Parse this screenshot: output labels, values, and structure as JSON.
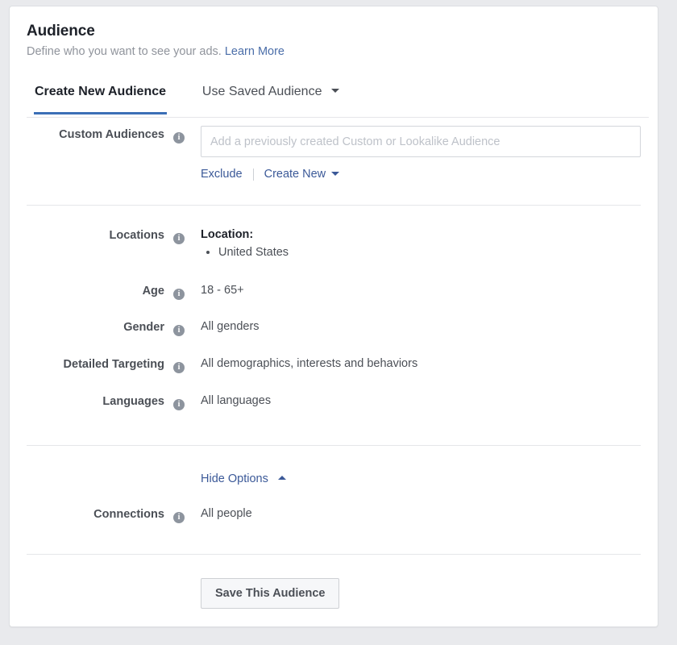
{
  "page": {
    "title": "Audience",
    "subtitle": "Define who you want to see your ads.",
    "learn_more": "Learn More"
  },
  "tabs": [
    {
      "label": "Create New Audience",
      "active": true
    },
    {
      "label": "Use Saved Audience",
      "active": false,
      "caret": "chevron-down"
    }
  ],
  "custom_audiences": {
    "label": "Custom Audiences",
    "info": "i",
    "placeholder": "Add a previously created Custom or Lookalike Audience",
    "value": "",
    "exclude_label": "Exclude",
    "create_new_label": "Create New"
  },
  "locations": {
    "label": "Locations",
    "info": "i",
    "value_title": "Location:",
    "items": [
      "United States"
    ]
  },
  "age": {
    "label": "Age",
    "info": "i",
    "value": "18 - 65+"
  },
  "gender": {
    "label": "Gender",
    "info": "i",
    "value": "All genders"
  },
  "detailed_targeting": {
    "label": "Detailed Targeting",
    "info": "i",
    "value": "All demographics, interests and behaviors"
  },
  "languages": {
    "label": "Languages",
    "info": "i",
    "value": "All languages"
  },
  "options_toggle": {
    "label": "Hide Options"
  },
  "connections": {
    "label": "Connections",
    "info": "i",
    "value": "All people"
  },
  "save_button": {
    "label": "Save This Audience"
  },
  "colors": {
    "accent_blue": "#3b6fb6",
    "link_blue": "#3b5998",
    "subtitle_link_blue": "#4b6ea9",
    "label_gray": "#4b4f56",
    "title_dark": "#1d2129",
    "placeholder_gray": "#bec2c9",
    "divider_gray": "#e5e6e9",
    "page_background": "#e9eaed",
    "card_background": "#ffffff",
    "info_icon_gray": "#8d949e",
    "button_background": "#f6f7f9"
  }
}
